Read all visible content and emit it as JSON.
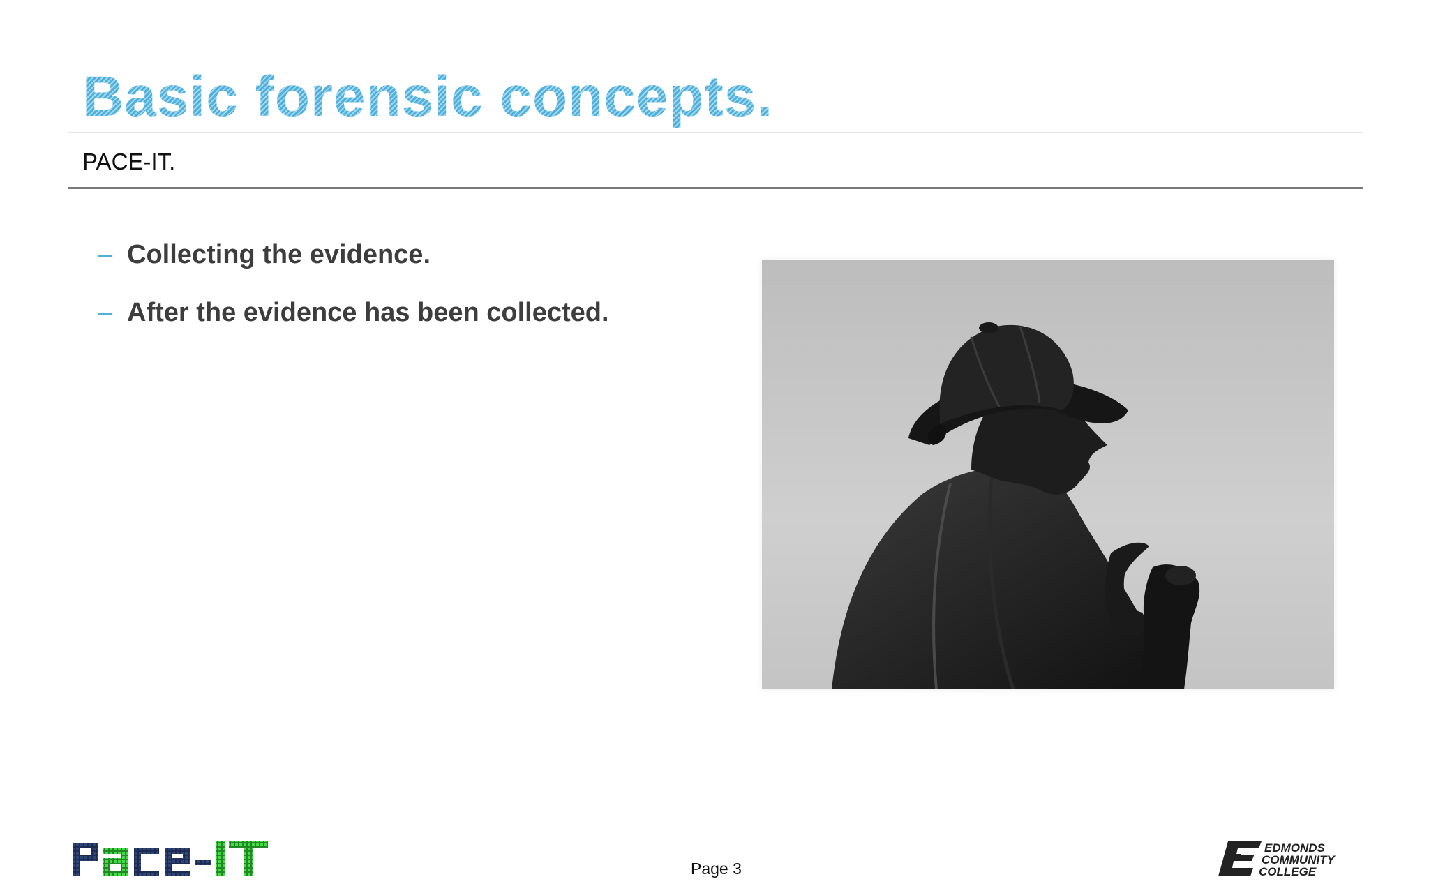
{
  "slide": {
    "title": "Basic forensic concepts.",
    "subtitle": "PACE-IT.",
    "bullets": [
      "Collecting the evidence.",
      "After the evidence has been collected."
    ],
    "page_label": "Page 3"
  },
  "image": {
    "subject": "statue-silhouette-deerstalker-pipe"
  },
  "footer": {
    "left_logo": "PACE-IT",
    "right_logo_lines": [
      "EDMONDS",
      "COMMUNITY",
      "COLLEGE"
    ]
  },
  "colors": {
    "title_blue": "#5ab4dc",
    "bullet_dash": "#4fb0dc",
    "body_text": "#3d3d3d",
    "logo_green": "#39c63a"
  }
}
